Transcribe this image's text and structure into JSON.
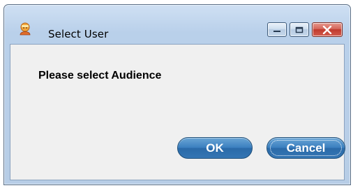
{
  "window": {
    "title": "Select User",
    "app_icon": "user-icon",
    "caption_buttons": {
      "minimize_icon": "minimize-icon",
      "maximize_icon": "maximize-icon",
      "close_icon": "close-icon"
    }
  },
  "dialog": {
    "message": "Please select Audience",
    "ok_label": "OK",
    "cancel_label": "Cancel"
  },
  "colors": {
    "frame": "#b9d0ea",
    "client_bg": "#f0f0f0",
    "button_blue": "#3b7fbf",
    "close_red": "#c0392c"
  }
}
